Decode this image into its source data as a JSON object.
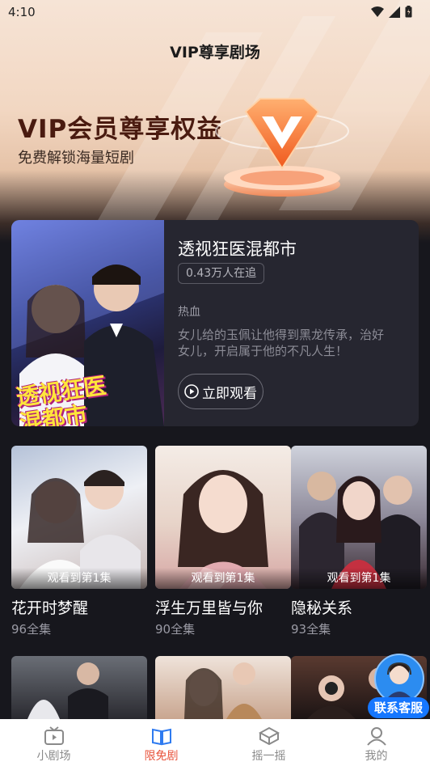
{
  "status_bar": {
    "time": "4:10"
  },
  "header": {
    "title": "VIP尊享剧场"
  },
  "banner": {
    "headline": "VIP会员尊享权益",
    "subtitle": "免费解锁海量短剧"
  },
  "featured": {
    "title": "透视狂医混都市",
    "followers": "0.43万人在追",
    "genre": "热血",
    "description": "女儿给的玉佩让他得到黑龙传承，治好女儿，开启属于他的不凡人生！",
    "watch_label": "立即观看",
    "poster_text": "透视狂医混都市"
  },
  "dramas": [
    {
      "title": "花开时梦醒",
      "episodes": "96全集",
      "progress": "观看到第1集"
    },
    {
      "title": "浮生万里皆与你",
      "episodes": "90全集",
      "progress": "观看到第1集"
    },
    {
      "title": "隐秘关系",
      "episodes": "93全集",
      "progress": "观看到第1集"
    }
  ],
  "support": {
    "label": "联系客服"
  },
  "tabs": [
    {
      "label": "小剧场",
      "icon": "tv-icon",
      "active": false
    },
    {
      "label": "限免剧",
      "icon": "book-icon",
      "active": true
    },
    {
      "label": "摇一摇",
      "icon": "cube-icon",
      "active": false
    },
    {
      "label": "我的",
      "icon": "user-icon",
      "active": false
    }
  ],
  "colors": {
    "accent": "#e8533b",
    "background": "#17171d",
    "card": "#262630",
    "support": "#1677ff"
  }
}
